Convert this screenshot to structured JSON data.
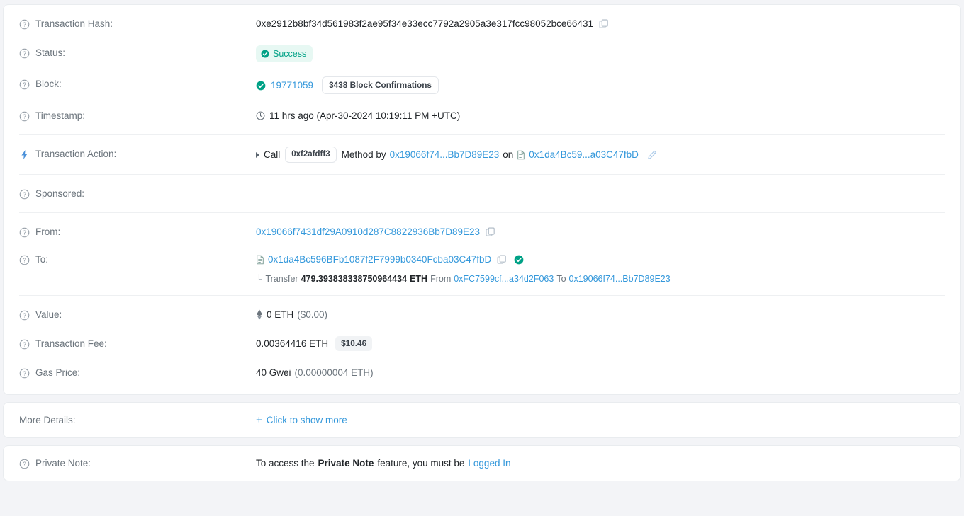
{
  "rows": {
    "transaction_hash": {
      "label": "Transaction Hash:",
      "value": "0xe2912b8bf34d561983f2ae95f34e33ecc7792a2905a3e317fcc98052bce66431"
    },
    "status": {
      "label": "Status:",
      "badge": "Success"
    },
    "block": {
      "label": "Block:",
      "number": "19771059",
      "confirmations": "3438 Block Confirmations"
    },
    "timestamp": {
      "label": "Timestamp:",
      "value": "11 hrs ago (Apr-30-2024 10:19:11 PM +UTC)"
    },
    "transaction_action": {
      "label": "Transaction Action:",
      "call_word": "Call",
      "method_badge": "0xf2afdff3",
      "method_by": "Method by",
      "caller": "0x19066f74...Bb7D89E23",
      "on_word": "on",
      "contract": "0x1da4Bc59...a03C47fbD"
    },
    "sponsored": {
      "label": "Sponsored:"
    },
    "from": {
      "label": "From:",
      "address": "0x19066f7431df29A0910d287C8822936Bb7D89E23"
    },
    "to": {
      "label": "To:",
      "address": "0x1da4Bc596BFb1087f2F7999b0340Fcba03C47fbD",
      "transfer_word": "Transfer",
      "transfer_amount": "479.393838338750964434",
      "transfer_unit": "ETH",
      "from_word": "From",
      "transfer_from": "0xFC7599cf...a34d2F063",
      "to_word": "To",
      "transfer_to": "0x19066f74...Bb7D89E23"
    },
    "value": {
      "label": "Value:",
      "amount": "0 ETH",
      "fiat": "($0.00)"
    },
    "transaction_fee": {
      "label": "Transaction Fee:",
      "amount": "0.00364416 ETH",
      "fiat_badge": "$10.46"
    },
    "gas_price": {
      "label": "Gas Price:",
      "amount": "40 Gwei",
      "eth": "(0.00000004 ETH)"
    },
    "more_details": {
      "label": "More Details:",
      "action": "Click to show more"
    },
    "private_note": {
      "label": "Private Note:",
      "text_before": "To access the",
      "text_bold": "Private Note",
      "text_middle": "feature, you must be",
      "link": "Logged In"
    }
  },
  "colors": {
    "link": "#3498db",
    "success": "#00a186",
    "success_bg": "#e7f8f3",
    "label": "#6c757d",
    "text": "#212529",
    "page_bg": "#f3f4f7"
  }
}
